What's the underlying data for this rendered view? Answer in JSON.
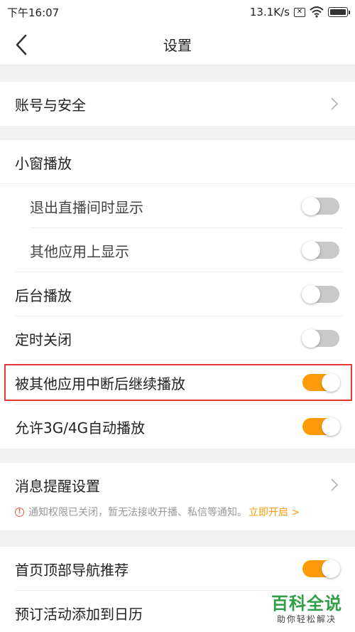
{
  "status_bar": {
    "time": "下午16:07",
    "network_speed": "13.1K/s",
    "sim_icon": "sim-x-icon",
    "wifi_icon": "wifi-icon",
    "battery_icon": "battery-icon"
  },
  "nav": {
    "back_icon": "chevron-left-icon",
    "title": "设置"
  },
  "account": {
    "label": "账号与安全",
    "chevron_icon": "chevron-right-icon"
  },
  "playback": {
    "mini_window_header": "小窗播放",
    "items": [
      {
        "label": "退出直播间时显示",
        "on": false
      },
      {
        "label": "其他应用上显示",
        "on": false
      }
    ],
    "background_play": {
      "label": "后台播放",
      "on": false
    },
    "timed_close": {
      "label": "定时关闭",
      "on": false
    },
    "resume_after_interrupt": {
      "label": "被其他应用中断后继续播放",
      "on": true
    },
    "allow_mobile_autoplay": {
      "label": "允许3G/4G自动播放",
      "on": true
    }
  },
  "notifications": {
    "label": "消息提醒设置",
    "notice_icon": "exclamation-circle-icon",
    "notice_text": "通知权限已关闭，暂无法接收开播、私信等通知。",
    "open_link": "立即开启 >"
  },
  "home": {
    "top_nav_recommend": {
      "label": "首页顶部导航推荐",
      "on": true
    },
    "add_to_calendar": {
      "label": "预订活动添加到日历"
    }
  },
  "watermark": {
    "title": "百科全说",
    "subtitle": "助你轻松解决"
  },
  "colors": {
    "accent": "#ff9b0b",
    "highlight_border": "#e53935",
    "switch_off": "#c9c9c9"
  }
}
